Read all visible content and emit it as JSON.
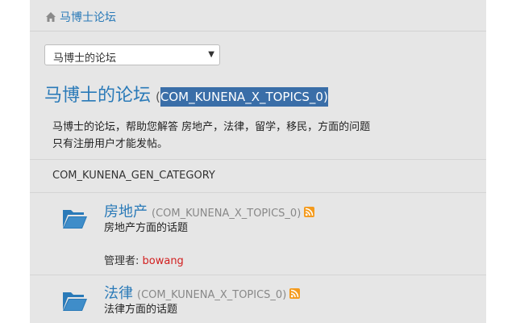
{
  "breadcrumb": {
    "label": "马博士论坛"
  },
  "forum_select": {
    "value": "马博士的论坛"
  },
  "forum": {
    "title": "马博士的论坛",
    "count_open": "(",
    "count_text": "COM_KUNENA_X_TOPICS_0)",
    "description_line1": "马博士的论坛，帮助您解答 房地产，法律，留学，移民，方面的问题",
    "description_line2": "只有注册用户才能发帖。"
  },
  "category_header": "COM_KUNENA_GEN_CATEGORY",
  "categories": [
    {
      "name": "房地产",
      "count": "(COM_KUNENA_X_TOPICS_0)",
      "description": "房地产方面的话题",
      "moderator_label": "管理者: ",
      "moderator_user": "bowang"
    },
    {
      "name": "法律",
      "count": "(COM_KUNENA_X_TOPICS_0)",
      "description": "法律方面的话题"
    }
  ],
  "colors": {
    "link": "#2a7ab8",
    "highlight": "#3a6ea8",
    "rss": "#f49b1e",
    "moderator": "#d21f1f",
    "folder": "#2a7ab8"
  },
  "icons": [
    "home-icon",
    "chevron-down-icon",
    "folder-icon",
    "rss-icon"
  ]
}
